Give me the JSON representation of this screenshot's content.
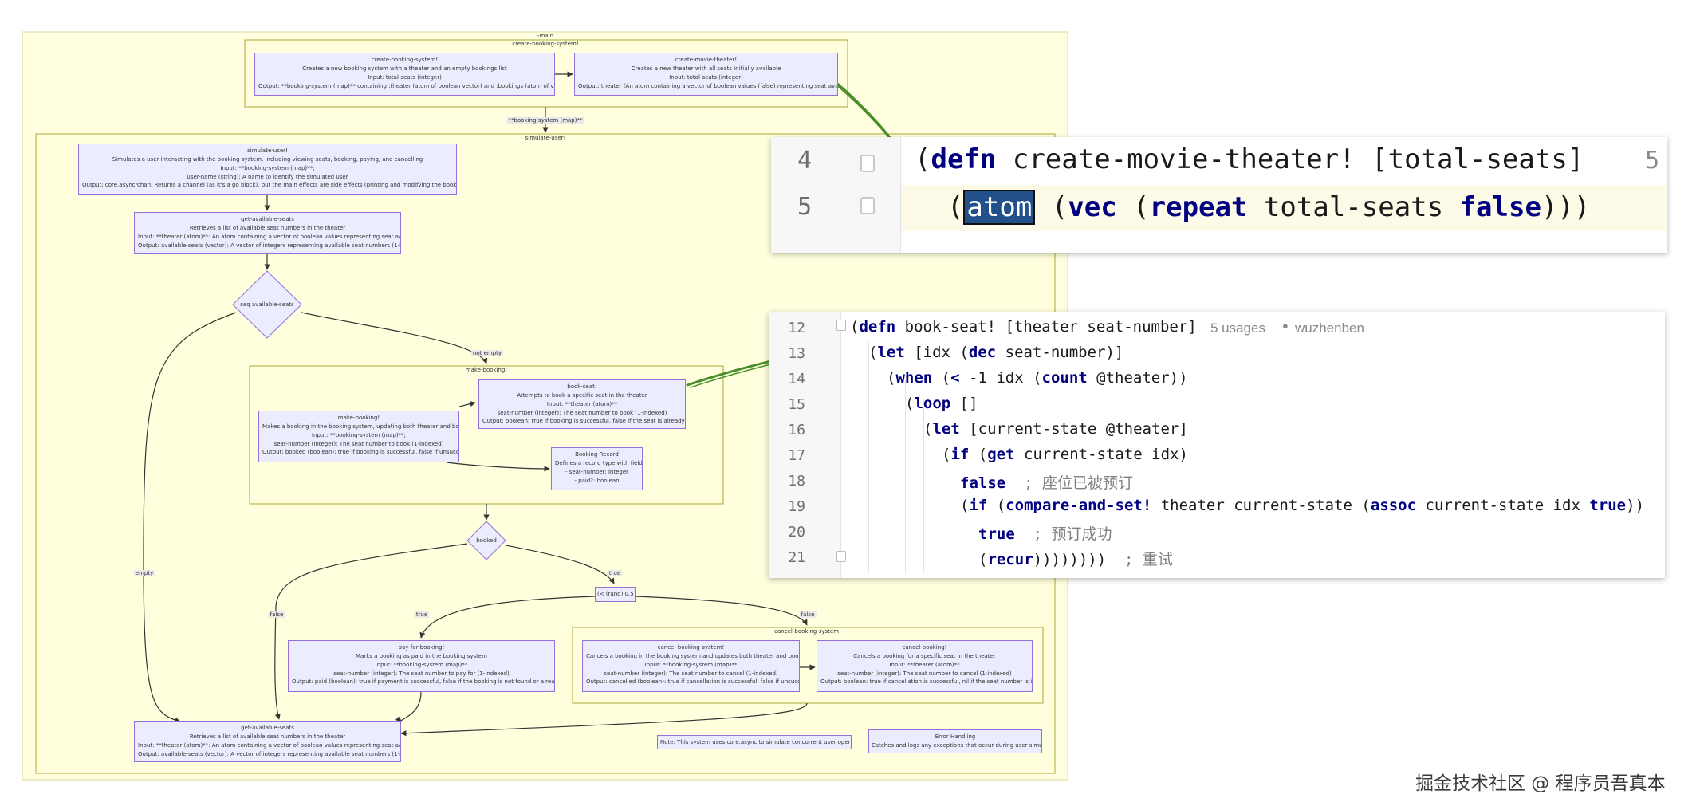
{
  "colors": {
    "background": "#ffffe0",
    "subgraph": "#ffffde",
    "node_fill": "#ececff",
    "node_border": "#9370db",
    "arrow_annotation": "#4a8f2a"
  },
  "flowchart": {
    "main_label": "-main",
    "create_group_label": "create-booking-system!",
    "create_booking": [
      "create-booking-system!",
      "Creates a new booking system with a theater and an empty bookings list",
      "Input: total-seats (integer)",
      "Output: **booking-system (map)** containing :theater (atom of boolean vector) and :bookings (atom of vector) keys"
    ],
    "create_theater": [
      "create-movie-theater!",
      "Creates a new theater with all seats initially available",
      "Input: total-seats (integer)",
      "Output: theater (An atom containing a vector of boolean values (false) representing seat availability)"
    ],
    "edge_booking_system": "**booking-system (map)**",
    "simulate_group_label": "simulate-user!",
    "simulate_user": [
      "simulate-user!",
      "Simulates a user interacting with the booking system, including viewing seats, booking, paying, and cancelling",
      "Input: **booking-system (map)**;",
      "user-name (string): A name to identify the simulated user",
      "Output: core.async/chan: Returns a channel (as it's a go block), but the main effects are side effects (printing and modifying the booking system)"
    ],
    "get_seats_top": [
      "get-available-seats",
      "Retrieves a list of available seat numbers in the theater",
      "Input: **theater (atom)**: An atom containing a vector of boolean values representing seat availability",
      "Output: available-seats (vector): A vector of integers representing available seat numbers (1-indexed)"
    ],
    "diamond_seq": "seq available-seats",
    "edge_not_empty": "not empty",
    "edge_empty": "empty",
    "make_group_label": "make-booking!",
    "book_seat": [
      "book-seat!",
      "Attempts to book a specific seat in the theater",
      "Input: **theater (atom)**",
      "seat-number (integer): The seat number to book (1-indexed)",
      "Output: boolean: true if booking is successful, false if the seat is already booked or invalid"
    ],
    "make_booking": [
      "make-booking!",
      "Makes a booking in the booking system, updating both theater and bookings",
      "Input: **booking-system (map)**;",
      "seat-number (integer): The seat number to book (1-indexed)",
      "Output: booked (boolean): true if booking is successful, false if unsuccessful"
    ],
    "booking_record": [
      "Booking Record",
      "Defines a record type with fields:",
      "- seat-number: integer",
      "- paid?: boolean"
    ],
    "diamond_booked": "booked",
    "edge_true": "true",
    "edge_false": "false",
    "rand_node": "(< (rand) 0.5)",
    "pay_for_booking": [
      "pay-for-booking!",
      "Marks a booking as paid in the booking system",
      "Input: **booking-system (map)**",
      "seat-number (integer): The seat number to pay for (1-indexed)",
      "Output: paid (boolean): true if payment is successful, false if the booking is not found or already paid"
    ],
    "cancel_group_label": "cancel-booking-system!",
    "cancel_system": [
      "cancel-booking-system!",
      "Cancels a booking in the booking system and updates both theater and bookings",
      "Input: **booking-system (map)**",
      "seat-number (integer): The seat number to cancel (1-indexed)",
      "Output: cancelled (boolean): true if cancellation is successful, false if unsuccessful"
    ],
    "cancel_booking": [
      "cancel-booking!",
      "Cancels a booking for a specific seat in the theater",
      "Input: **theater (atom)**",
      "seat-number (integer): The seat number to cancel (1-indexed)",
      "Output: boolean: true if cancellation is successful, nil if the seat number is invalid"
    ],
    "get_seats_bottom": [
      "get-available-seats",
      "Retrieves a list of available seat numbers in the theater",
      "Input: **theater (atom)**: An atom containing a vector of boolean values representing seat availability",
      "Output: available-seats (vector): A vector of integers representing available seat numbers (1-indexed)"
    ],
    "note": "Note: This system uses core.async to simulate concurrent user operations",
    "error_handling": [
      "Error Handling",
      "Catches and logs any exceptions that occur during user simulation"
    ]
  },
  "code_panel_1": {
    "line_numbers": [
      "4",
      "5"
    ],
    "right_number": "5",
    "line4": {
      "open": "(",
      "kw": "defn",
      "rest": " create-movie-theater! [total-seats]"
    },
    "line5": {
      "indent": "  (",
      "atom": "atom",
      "sp": " (",
      "vec": "vec",
      "sp2": " (",
      "repeat": "repeat",
      "mid": " total-seats ",
      "false": "false",
      "close": ")))"
    }
  },
  "code_panel_2": {
    "line_numbers": [
      "12",
      "13",
      "14",
      "15",
      "16",
      "17",
      "18",
      "19",
      "20",
      "21"
    ],
    "usages": "5 usages",
    "author": "wuzhenben",
    "l12": {
      "open": "(",
      "kw": "defn",
      "rest": " book-seat! [theater seat-number]"
    },
    "l13": {
      "open": "(",
      "kw": "let",
      "mid": " [idx (",
      "kw2": "dec",
      "rest": " seat-number)]"
    },
    "l14": {
      "open": "(",
      "kw": "when",
      "mid": " (",
      "kw2": "<",
      "mid2": " -1 idx (",
      "kw3": "count",
      "rest": " @theater))"
    },
    "l15": {
      "open": "(",
      "kw": "loop",
      "rest": " []"
    },
    "l16": {
      "open": "(",
      "kw": "let",
      "rest": " [current-state @theater]"
    },
    "l17": {
      "open": "(",
      "kw": "if",
      "mid": " (",
      "kw2": "get",
      "rest": " current-state idx)"
    },
    "l18": {
      "kw": "false",
      "comment": "  ; 座位已被预订"
    },
    "l19": {
      "open": "(",
      "kw": "if",
      "mid": " (",
      "kw2": "compare-and-set!",
      "mid2": " theater current-state (",
      "kw3": "assoc",
      "mid3": " current-state idx ",
      "kw4": "true",
      "rest": "))"
    },
    "l20": {
      "kw": "true",
      "comment": "  ; 预订成功"
    },
    "l21": {
      "open": "(",
      "kw": "recur",
      "rest": "))))))))",
      "comment": "  ; 重试"
    }
  },
  "watermark": "掘金技术社区 @ 程序员吾真本"
}
